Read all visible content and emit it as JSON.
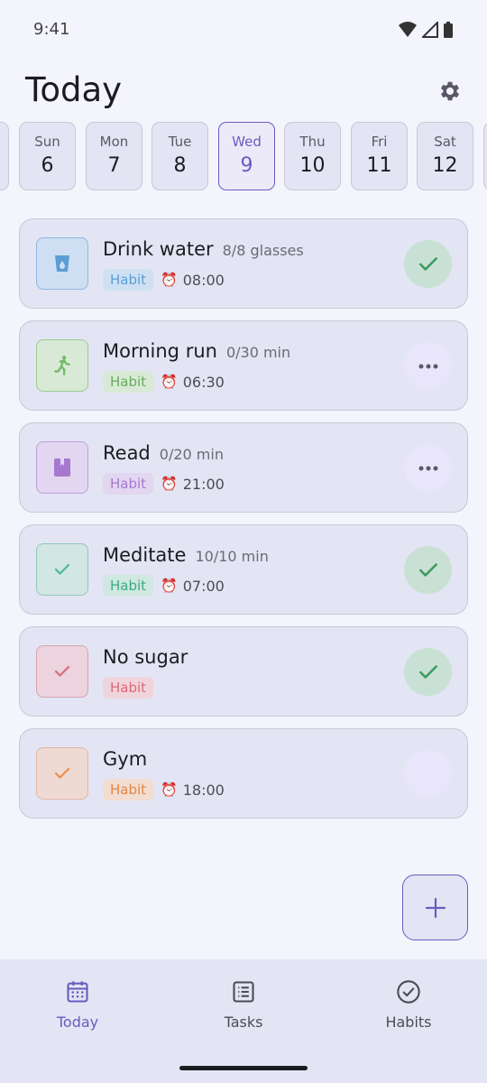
{
  "status_bar": {
    "time": "9:41"
  },
  "header": {
    "title": "Today"
  },
  "date_strip": [
    {
      "dow": "",
      "dom": ""
    },
    {
      "dow": "Sun",
      "dom": "6"
    },
    {
      "dow": "Mon",
      "dom": "7"
    },
    {
      "dow": "Tue",
      "dom": "8"
    },
    {
      "dow": "Wed",
      "dom": "9",
      "selected": true
    },
    {
      "dow": "Thu",
      "dom": "10"
    },
    {
      "dow": "Fri",
      "dom": "11"
    },
    {
      "dow": "Sat",
      "dom": "12"
    },
    {
      "dow": "",
      "dom": ""
    }
  ],
  "tasks": [
    {
      "title": "Drink water",
      "progress": "8/8 glasses",
      "tag": "Habit",
      "time": "08:00",
      "icon": "water-glass-icon",
      "color": "#5a9fd4",
      "action": "done"
    },
    {
      "title": "Morning run",
      "progress": "0/30 min",
      "tag": "Habit",
      "time": "06:30",
      "icon": "running-icon",
      "color": "#76b86a",
      "action": "more"
    },
    {
      "title": "Read",
      "progress": "0/20 min",
      "tag": "Habit",
      "time": "21:00",
      "icon": "book-icon",
      "color": "#a679cf",
      "action": "more"
    },
    {
      "title": "Meditate",
      "progress": "10/10 min",
      "tag": "Habit",
      "time": "07:00",
      "icon": "check-icon",
      "color": "#4db88f",
      "action": "done"
    },
    {
      "title": "No sugar",
      "progress": "",
      "tag": "Habit",
      "time": "",
      "icon": "check-icon",
      "color": "#d96a7a",
      "action": "done"
    },
    {
      "title": "Gym",
      "progress": "",
      "tag": "Habit",
      "time": "18:00",
      "icon": "check-icon",
      "color": "#e8904f",
      "action": "empty"
    }
  ],
  "nav": [
    {
      "label": "Today",
      "icon": "calendar-icon",
      "active": true
    },
    {
      "label": "Tasks",
      "icon": "list-icon",
      "active": false
    },
    {
      "label": "Habits",
      "icon": "check-circle-icon",
      "active": false
    }
  ],
  "colors": {
    "accent": "#6b5bc0",
    "done_check": "#3f9a62"
  }
}
